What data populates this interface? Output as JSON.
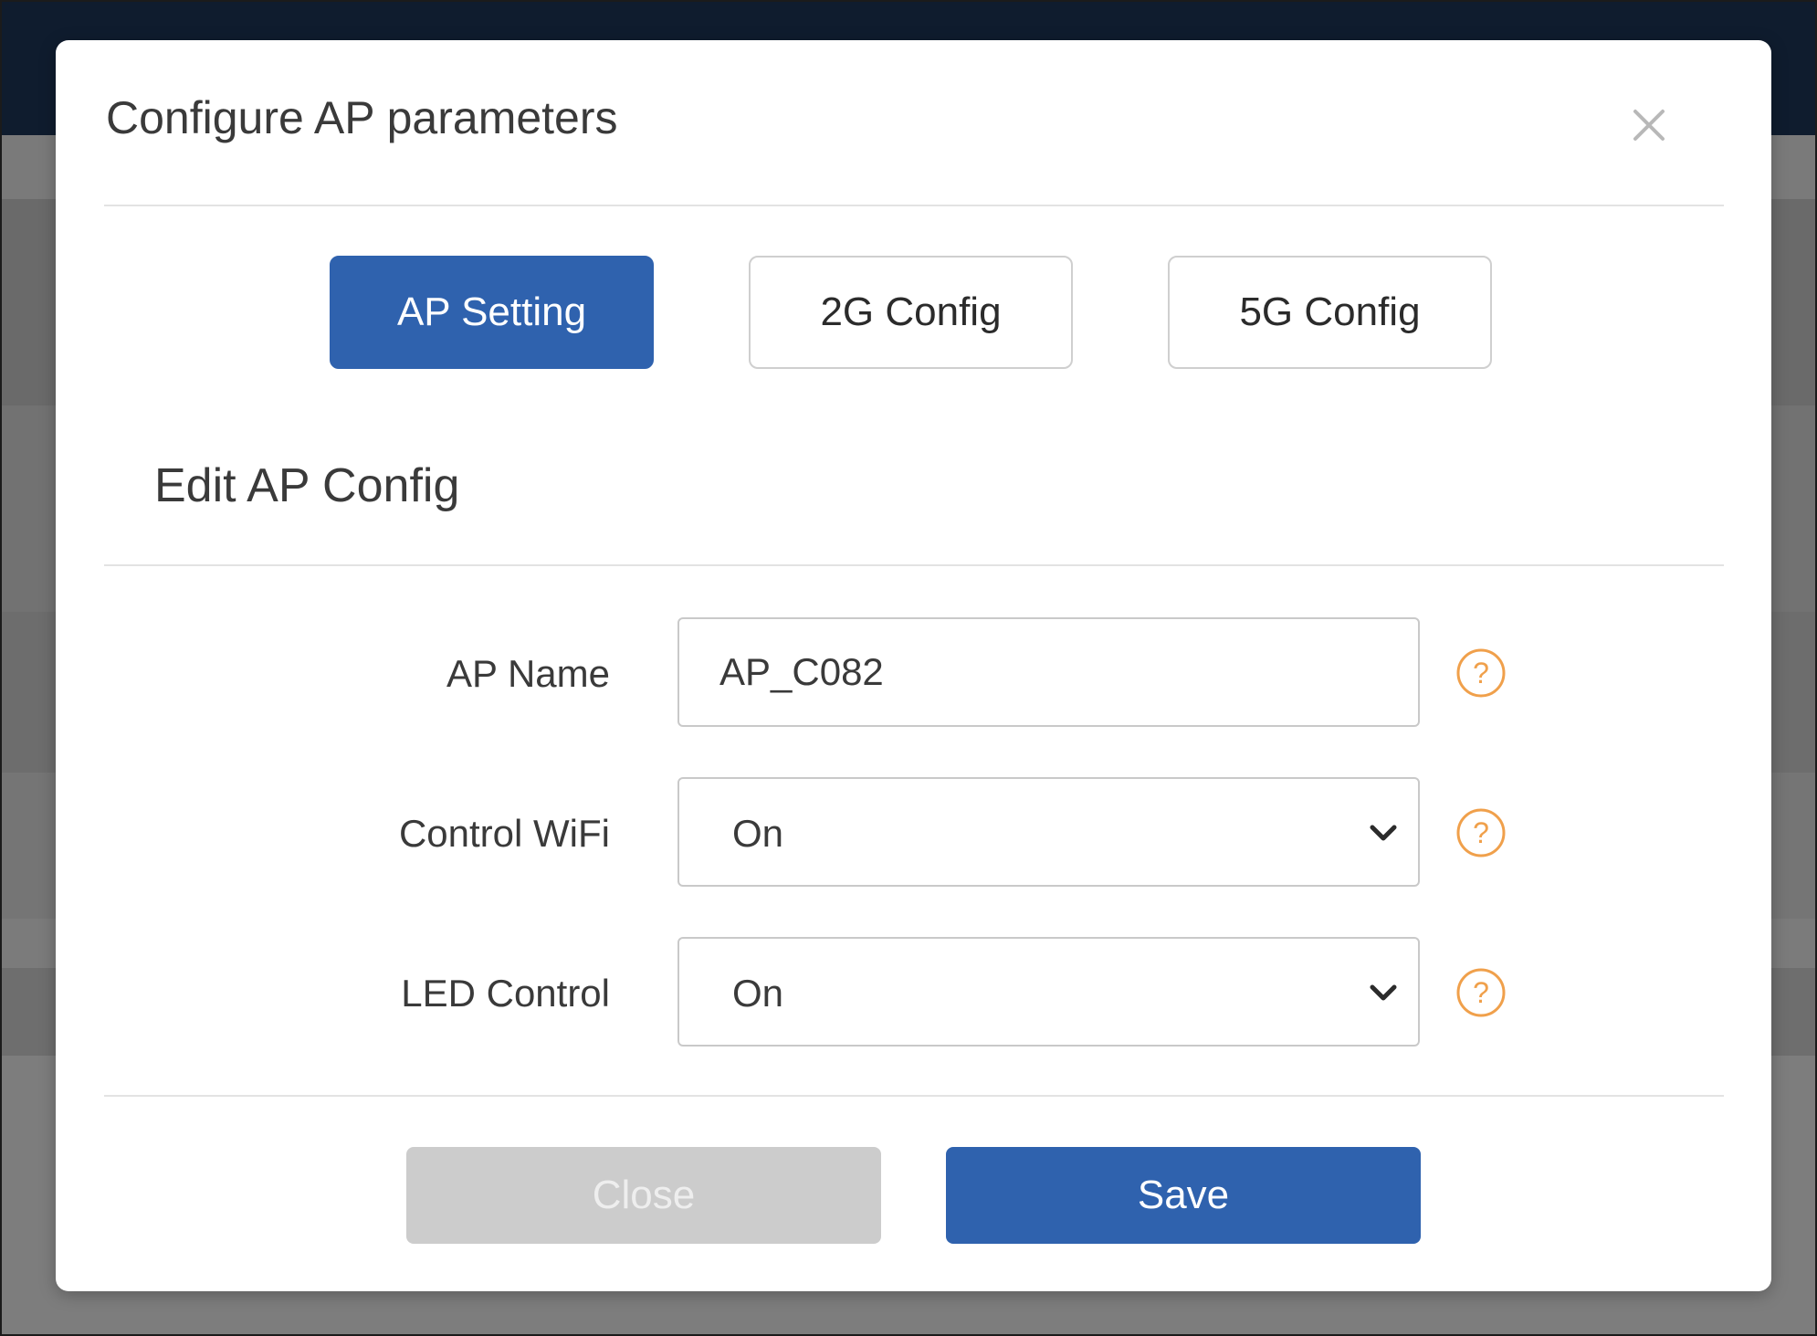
{
  "dialog": {
    "title": "Configure AP parameters",
    "close_icon": "close-icon"
  },
  "tabs": [
    {
      "label": "AP Setting",
      "active": true
    },
    {
      "label": "2G Config",
      "active": false
    },
    {
      "label": "5G Config",
      "active": false
    }
  ],
  "section": {
    "title": "Edit AP Config"
  },
  "form": {
    "ap_name": {
      "label": "AP Name",
      "value": "AP_C082",
      "help_icon": "question-circle-icon"
    },
    "control_wifi": {
      "label": "Control WiFi",
      "value": "On",
      "dropdown_icon": "chevron-down-icon",
      "help_icon": "question-circle-icon"
    },
    "led_control": {
      "label": "LED Control",
      "value": "On",
      "dropdown_icon": "chevron-down-icon",
      "help_icon": "question-circle-icon"
    }
  },
  "footer": {
    "close_label": "Close",
    "save_label": "Save"
  },
  "colors": {
    "primary": "#2f62ae",
    "help_icon": "#f0a04b",
    "disabled_button": "#cccccc",
    "header_bar": "#0f1c2e"
  }
}
